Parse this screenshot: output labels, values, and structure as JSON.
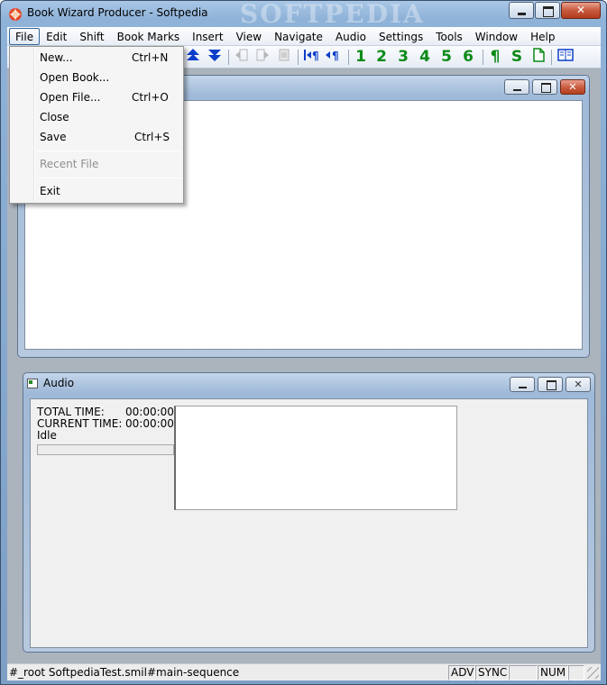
{
  "window": {
    "title": "Book Wizard Producer - Softpedia",
    "watermark": "SOFTPEDIA",
    "minimize_glyph": "",
    "close_glyph": "✕"
  },
  "menubar": {
    "items": [
      "File",
      "Edit",
      "Shift",
      "Book Marks",
      "Insert",
      "View",
      "Navigate",
      "Audio",
      "Settings",
      "Tools",
      "Window",
      "Help"
    ],
    "active": "File"
  },
  "toolbar": {
    "numbers": [
      "1",
      "2",
      "3",
      "4",
      "5",
      "6"
    ],
    "pilcrow": "¶",
    "section": "S",
    "accent_green": "#0a8a17",
    "accent_blue": "#0a3dc9"
  },
  "file_menu": {
    "new": {
      "label": "New...",
      "shortcut": "Ctrl+N"
    },
    "open_book": {
      "label": "Open Book..."
    },
    "open_file": {
      "label": "Open File...",
      "shortcut": "Ctrl+O"
    },
    "close": {
      "label": "Close"
    },
    "save": {
      "label": "Save",
      "shortcut": "Ctrl+S"
    },
    "recent_file": {
      "label": "Recent File"
    },
    "exit": {
      "label": "Exit"
    }
  },
  "document_window": {
    "close_glyph": "✕"
  },
  "audio_window": {
    "title": "Audio",
    "total_time_label": "TOTAL TIME:",
    "total_time_value": "00:00:00",
    "current_time_label": "CURRENT TIME:",
    "current_time_value": "00:00:00",
    "state": "Idle",
    "close_glyph": "✕"
  },
  "statusbar": {
    "text": "#_root SoftpediaTest.smil#main-sequence",
    "adv": "ADV",
    "sync": "SYNC",
    "num": "NUM"
  }
}
